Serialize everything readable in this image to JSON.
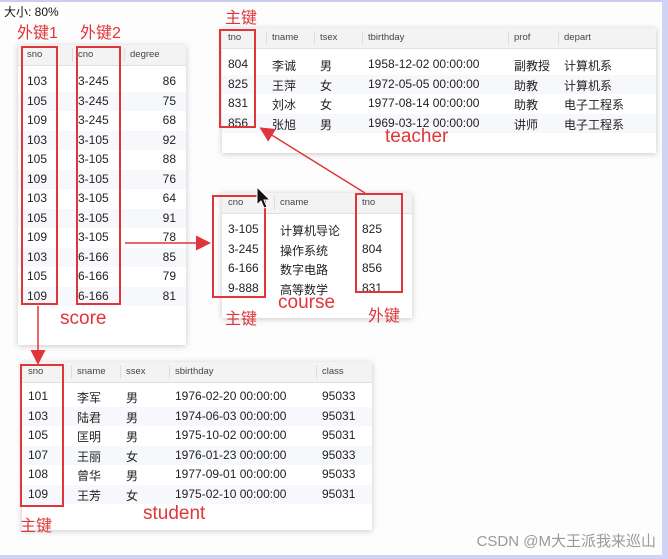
{
  "zoom_label": "大小: 80%",
  "watermark": "CSDN @M大王派我来巡山",
  "accent_color": "#e0353a",
  "score": {
    "name": "score",
    "columns": [
      "sno",
      "cno",
      "degree"
    ],
    "rows": [
      [
        "103",
        "3-245",
        "86"
      ],
      [
        "105",
        "3-245",
        "75"
      ],
      [
        "109",
        "3-245",
        "68"
      ],
      [
        "103",
        "3-105",
        "92"
      ],
      [
        "105",
        "3-105",
        "88"
      ],
      [
        "109",
        "3-105",
        "76"
      ],
      [
        "103",
        "3-105",
        "64"
      ],
      [
        "105",
        "3-105",
        "91"
      ],
      [
        "109",
        "3-105",
        "78"
      ],
      [
        "103",
        "6-166",
        "85"
      ],
      [
        "105",
        "6-166",
        "79"
      ],
      [
        "109",
        "6-166",
        "81"
      ]
    ],
    "fk1_label": "外键1",
    "fk2_label": "外键2"
  },
  "teacher": {
    "name": "teacher",
    "columns": [
      "tno",
      "tname",
      "tsex",
      "tbirthday",
      "prof",
      "depart"
    ],
    "rows": [
      [
        "804",
        "李诚",
        "男",
        "1958-12-02 00:00:00",
        "副教授",
        "计算机系"
      ],
      [
        "825",
        "王萍",
        "女",
        "1972-05-05 00:00:00",
        "助教",
        "计算机系"
      ],
      [
        "831",
        "刘冰",
        "女",
        "1977-08-14 00:00:00",
        "助教",
        "电子工程系"
      ],
      [
        "856",
        "张旭",
        "男",
        "1969-03-12 00:00:00",
        "讲师",
        "电子工程系"
      ]
    ],
    "pk_label": "主键"
  },
  "course": {
    "name": "course",
    "columns": [
      "cno",
      "cname",
      "tno"
    ],
    "rows": [
      [
        "3-105",
        "计算机导论",
        "825"
      ],
      [
        "3-245",
        "操作系统",
        "804"
      ],
      [
        "6-166",
        "数字电路",
        "856"
      ],
      [
        "9-888",
        "高等数学",
        "831"
      ]
    ],
    "pk_label": "主键",
    "fk_label": "外键"
  },
  "student": {
    "name": "student",
    "columns": [
      "sno",
      "sname",
      "ssex",
      "sbirthday",
      "class"
    ],
    "rows": [
      [
        "101",
        "李军",
        "男",
        "1976-02-20 00:00:00",
        "95033"
      ],
      [
        "103",
        "陆君",
        "男",
        "1974-06-03 00:00:00",
        "95031"
      ],
      [
        "105",
        "匡明",
        "男",
        "1975-10-02 00:00:00",
        "95031"
      ],
      [
        "107",
        "王丽",
        "女",
        "1976-01-23 00:00:00",
        "95033"
      ],
      [
        "108",
        "曾华",
        "男",
        "1977-09-01 00:00:00",
        "95033"
      ],
      [
        "109",
        "王芳",
        "女",
        "1975-02-10 00:00:00",
        "95031"
      ]
    ],
    "pk_label": "主键"
  }
}
